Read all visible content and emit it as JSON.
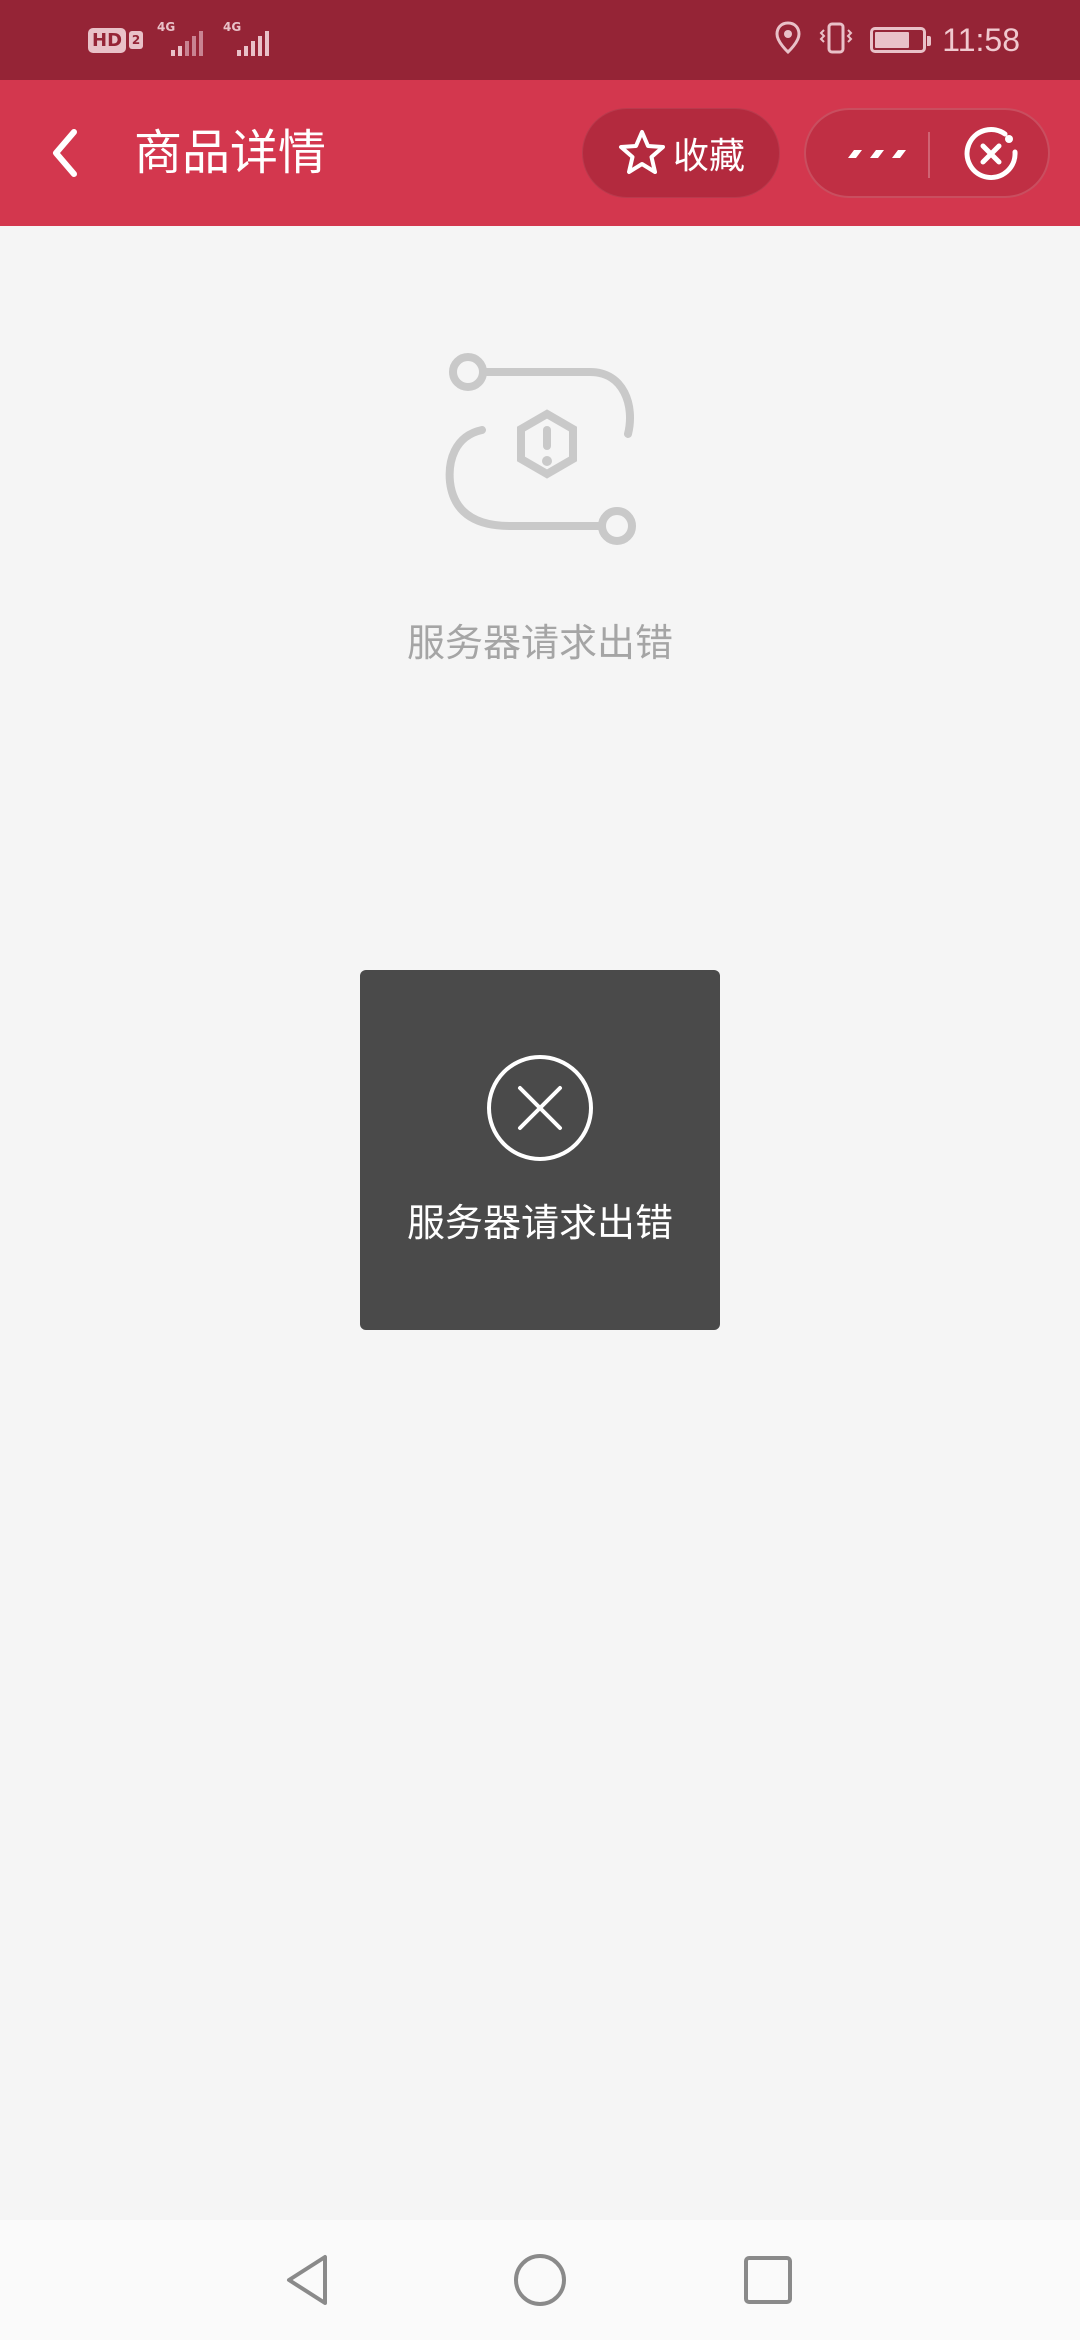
{
  "status_bar": {
    "hd_label": "HD",
    "sim_label": "2",
    "network_1": "4G",
    "network_2": "4G",
    "battery_level": 0.75,
    "time": "11:58"
  },
  "nav": {
    "title": "商品详情",
    "favorite_label": "收藏",
    "back_icon": "chevron-left-icon",
    "favorite_icon": "star-outline-icon",
    "more_icon": "more-dots-icon",
    "close_icon": "close-circle-icon"
  },
  "main": {
    "error_message": "服务器请求出错",
    "illustration_icon": "network-error-icon"
  },
  "toast": {
    "message": "服务器请求出错",
    "icon": "close-circle-icon"
  },
  "system_nav": {
    "back_icon": "triangle-back-icon",
    "home_icon": "circle-home-icon",
    "recents_icon": "square-recents-icon"
  },
  "colors": {
    "status_bar": "#952436",
    "nav_bar": "#d3374e",
    "background": "#f5f5f5",
    "toast_bg": "#4a4a4a"
  }
}
